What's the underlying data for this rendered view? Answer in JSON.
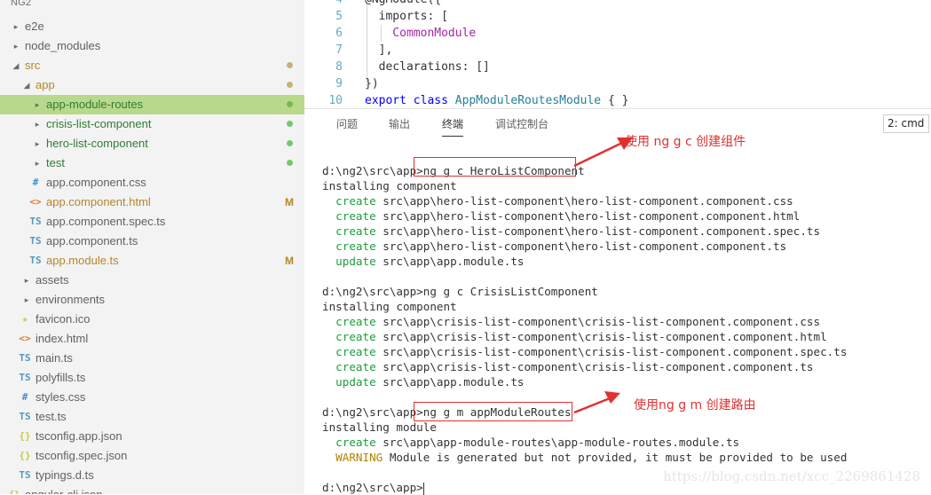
{
  "sidebar": {
    "project": "NG2",
    "items": [
      {
        "label": "e2e",
        "icon": "",
        "arrow": "▸",
        "color": "#616161"
      },
      {
        "label": "node_modules",
        "icon": "",
        "arrow": "▸",
        "color": "#616161"
      },
      {
        "label": "src",
        "icon": "",
        "arrow": "◢",
        "color": "#b5862a",
        "status": "dot",
        "status_color": "#c9b07a"
      },
      {
        "label": "app",
        "icon": "",
        "arrow": "◢",
        "color": "#b5862a",
        "status": "dot",
        "status_color": "#c9b07a"
      },
      {
        "label": "app-module-routes",
        "icon": "",
        "arrow": "▸",
        "color": "#2e7d32",
        "status": "dot",
        "status_color": "#7fb352",
        "selected": true
      },
      {
        "label": "crisis-list-component",
        "icon": "",
        "arrow": "▸",
        "color": "#2e7d32",
        "status": "dot",
        "status_color": "#73c96d"
      },
      {
        "label": "hero-list-component",
        "icon": "",
        "arrow": "▸",
        "color": "#2e7d32",
        "status": "dot",
        "status_color": "#73c96d"
      },
      {
        "label": "test",
        "icon": "",
        "arrow": "▸",
        "color": "#2e7d32",
        "status": "dot",
        "status_color": "#73c96d"
      },
      {
        "label": "app.component.css",
        "icon": "#",
        "icon_color": "#3f8fd2",
        "color": "#616161"
      },
      {
        "label": "app.component.html",
        "icon": "<>",
        "icon_color": "#e37933",
        "color": "#b5862a",
        "status": "M",
        "status_color": "#b5862a"
      },
      {
        "label": "app.component.spec.ts",
        "icon": "TS",
        "icon_color": "#519aba",
        "color": "#616161"
      },
      {
        "label": "app.component.ts",
        "icon": "TS",
        "icon_color": "#519aba",
        "color": "#616161"
      },
      {
        "label": "app.module.ts",
        "icon": "TS",
        "icon_color": "#519aba",
        "color": "#b5862a",
        "status": "M",
        "status_color": "#b5862a"
      },
      {
        "label": "assets",
        "icon": "",
        "arrow": "▸",
        "color": "#616161"
      },
      {
        "label": "environments",
        "icon": "",
        "arrow": "▸",
        "color": "#616161"
      },
      {
        "label": "favicon.ico",
        "icon": "★",
        "icon_color": "#cbcb41",
        "color": "#616161"
      },
      {
        "label": "index.html",
        "icon": "<>",
        "icon_color": "#e37933",
        "color": "#616161"
      },
      {
        "label": "main.ts",
        "icon": "TS",
        "icon_color": "#519aba",
        "color": "#616161"
      },
      {
        "label": "polyfills.ts",
        "icon": "TS",
        "icon_color": "#519aba",
        "color": "#616161"
      },
      {
        "label": "styles.css",
        "icon": "#",
        "icon_color": "#3f8fd2",
        "color": "#616161"
      },
      {
        "label": "test.ts",
        "icon": "TS",
        "icon_color": "#519aba",
        "color": "#616161"
      },
      {
        "label": "tsconfig.app.json",
        "icon": "{}",
        "icon_color": "#cbcb41",
        "color": "#616161"
      },
      {
        "label": "tsconfig.spec.json",
        "icon": "{}",
        "icon_color": "#cbcb41",
        "color": "#616161"
      },
      {
        "label": "typings.d.ts",
        "icon": "TS",
        "icon_color": "#519aba",
        "color": "#616161"
      },
      {
        "label": "angular-cli.json",
        "icon": "{}",
        "icon_color": "#cbcb41",
        "color": "#616161"
      }
    ]
  },
  "editor": {
    "lines": [
      {
        "num": "4",
        "text": "@NgModule({"
      },
      {
        "num": "5",
        "text": "  imports: ["
      },
      {
        "num": "6",
        "text": "    CommonModule"
      },
      {
        "num": "7",
        "text": "  ],"
      },
      {
        "num": "8",
        "text": "  declarations: []"
      },
      {
        "num": "9",
        "text": "})"
      },
      {
        "num": "10",
        "text": "export class AppModuleRoutesModule { }"
      }
    ]
  },
  "panel": {
    "tabs": [
      "问题",
      "输出",
      "终端",
      "调试控制台"
    ],
    "active_tab": "终端",
    "terminal_select": "2: cmd"
  },
  "terminal": {
    "lines": [
      {
        "pre": "d:\\ng2\\src\\app>",
        "text": "ng g c HeroListComponent"
      },
      {
        "text": "installing component"
      },
      {
        "kw": "  create",
        "text": " src\\app\\hero-list-component\\hero-list-component.component.css"
      },
      {
        "kw": "  create",
        "text": " src\\app\\hero-list-component\\hero-list-component.component.html"
      },
      {
        "kw": "  create",
        "text": " src\\app\\hero-list-component\\hero-list-component.component.spec.ts"
      },
      {
        "kw": "  create",
        "text": " src\\app\\hero-list-component\\hero-list-component.component.ts"
      },
      {
        "kw": "  update",
        "text": " src\\app\\app.module.ts"
      },
      {
        "text": ""
      },
      {
        "pre": "d:\\ng2\\src\\app>",
        "text": "ng g c CrisisListComponent"
      },
      {
        "text": "installing component"
      },
      {
        "kw": "  create",
        "text": " src\\app\\crisis-list-component\\crisis-list-component.component.css"
      },
      {
        "kw": "  create",
        "text": " src\\app\\crisis-list-component\\crisis-list-component.component.html"
      },
      {
        "kw": "  create",
        "text": " src\\app\\crisis-list-component\\crisis-list-component.component.spec.ts"
      },
      {
        "kw": "  create",
        "text": " src\\app\\crisis-list-component\\crisis-list-component.component.ts"
      },
      {
        "kw": "  update",
        "text": " src\\app\\app.module.ts"
      },
      {
        "text": ""
      },
      {
        "pre": "d:\\ng2\\src\\app>",
        "text": "ng g m appModuleRoutes"
      },
      {
        "text": "installing module"
      },
      {
        "kw": "  create",
        "text": " src\\app\\app-module-routes\\app-module-routes.module.ts"
      },
      {
        "warn": "  WARNING",
        "text": " Module is generated but not provided, it must be provided to be used"
      },
      {
        "text": ""
      },
      {
        "pre": "d:\\ng2\\src\\app>",
        "text": ""
      }
    ],
    "prompt_first": "d:\\ng2\\src\\app>"
  },
  "annotations": {
    "note1": "使用 ng g c 创建组件",
    "note2": "使用ng g m 创建路由",
    "color": "#e03131"
  },
  "watermark": "https://blog.csdn.net/xcc_2269861428"
}
